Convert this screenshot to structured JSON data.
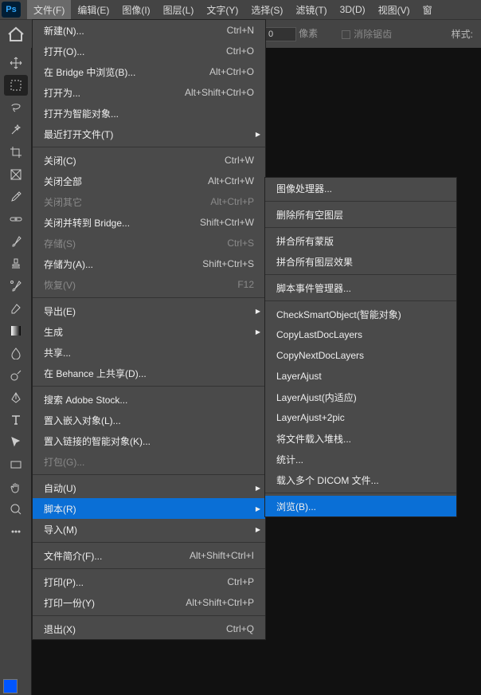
{
  "logo": "Ps",
  "menubar": [
    {
      "label": "文件(F)"
    },
    {
      "label": "编辑(E)"
    },
    {
      "label": "图像(I)"
    },
    {
      "label": "图层(L)"
    },
    {
      "label": "文字(Y)"
    },
    {
      "label": "选择(S)"
    },
    {
      "label": "滤镜(T)"
    },
    {
      "label": "3D(D)"
    },
    {
      "label": "视图(V)"
    },
    {
      "label": "窗"
    }
  ],
  "optionsbar": {
    "px_value": "0",
    "px_label": "像素",
    "antialias": "消除锯齿",
    "style": "样式:"
  },
  "file_menu": [
    {
      "label": "新建(N)...",
      "shortcut": "Ctrl+N"
    },
    {
      "label": "打开(O)...",
      "shortcut": "Ctrl+O"
    },
    {
      "label": "在 Bridge 中浏览(B)...",
      "shortcut": "Alt+Ctrl+O"
    },
    {
      "label": "打开为...",
      "shortcut": "Alt+Shift+Ctrl+O"
    },
    {
      "label": "打开为智能对象...",
      "shortcut": ""
    },
    {
      "label": "最近打开文件(T)",
      "shortcut": "",
      "arrow": true
    },
    {
      "sep": true
    },
    {
      "label": "关闭(C)",
      "shortcut": "Ctrl+W"
    },
    {
      "label": "关闭全部",
      "shortcut": "Alt+Ctrl+W"
    },
    {
      "label": "关闭其它",
      "shortcut": "Alt+Ctrl+P",
      "disabled": true
    },
    {
      "label": "关闭并转到 Bridge...",
      "shortcut": "Shift+Ctrl+W"
    },
    {
      "label": "存储(S)",
      "shortcut": "Ctrl+S",
      "disabled": true
    },
    {
      "label": "存储为(A)...",
      "shortcut": "Shift+Ctrl+S"
    },
    {
      "label": "恢复(V)",
      "shortcut": "F12",
      "disabled": true
    },
    {
      "sep": true
    },
    {
      "label": "导出(E)",
      "shortcut": "",
      "arrow": true
    },
    {
      "label": "生成",
      "shortcut": "",
      "arrow": true
    },
    {
      "label": "共享...",
      "shortcut": ""
    },
    {
      "label": "在 Behance 上共享(D)...",
      "shortcut": ""
    },
    {
      "sep": true
    },
    {
      "label": "搜索 Adobe Stock...",
      "shortcut": ""
    },
    {
      "label": "置入嵌入对象(L)...",
      "shortcut": ""
    },
    {
      "label": "置入链接的智能对象(K)...",
      "shortcut": ""
    },
    {
      "label": "打包(G)...",
      "shortcut": "",
      "disabled": true
    },
    {
      "sep": true
    },
    {
      "label": "自动(U)",
      "shortcut": "",
      "arrow": true
    },
    {
      "label": "脚本(R)",
      "shortcut": "",
      "arrow": true,
      "highlight": true
    },
    {
      "label": "导入(M)",
      "shortcut": "",
      "arrow": true
    },
    {
      "sep": true
    },
    {
      "label": "文件简介(F)...",
      "shortcut": "Alt+Shift+Ctrl+I"
    },
    {
      "sep": true
    },
    {
      "label": "打印(P)...",
      "shortcut": "Ctrl+P"
    },
    {
      "label": "打印一份(Y)",
      "shortcut": "Alt+Shift+Ctrl+P"
    },
    {
      "sep": true
    },
    {
      "label": "退出(X)",
      "shortcut": "Ctrl+Q"
    }
  ],
  "scripts_menu": [
    {
      "label": "图像处理器...",
      "shortcut": ""
    },
    {
      "sep": true
    },
    {
      "label": "删除所有空图层",
      "shortcut": ""
    },
    {
      "sep": true
    },
    {
      "label": "拼合所有蒙版",
      "shortcut": ""
    },
    {
      "label": "拼合所有图层效果",
      "shortcut": ""
    },
    {
      "sep": true
    },
    {
      "label": "脚本事件管理器...",
      "shortcut": ""
    },
    {
      "sep": true
    },
    {
      "label": "CheckSmartObject(智能对象)",
      "shortcut": ""
    },
    {
      "label": "CopyLastDocLayers",
      "shortcut": ""
    },
    {
      "label": "CopyNextDocLayers",
      "shortcut": ""
    },
    {
      "label": "LayerAjust",
      "shortcut": ""
    },
    {
      "label": "LayerAjust(内适应)",
      "shortcut": ""
    },
    {
      "label": "LayerAjust+2pic",
      "shortcut": ""
    },
    {
      "label": "将文件载入堆栈...",
      "shortcut": ""
    },
    {
      "label": "统计...",
      "shortcut": ""
    },
    {
      "label": "载入多个 DICOM 文件...",
      "shortcut": ""
    },
    {
      "sep": true
    },
    {
      "label": "浏览(B)...",
      "shortcut": "",
      "highlight": true
    }
  ],
  "tools": [
    "move",
    "marquee",
    "lasso",
    "wand",
    "crop",
    "frame",
    "eyedropper",
    "heal",
    "brush",
    "stamp",
    "history",
    "eraser",
    "gradient",
    "blur",
    "dodge",
    "pen",
    "type",
    "path",
    "rect",
    "hand",
    "zoom",
    "more"
  ]
}
